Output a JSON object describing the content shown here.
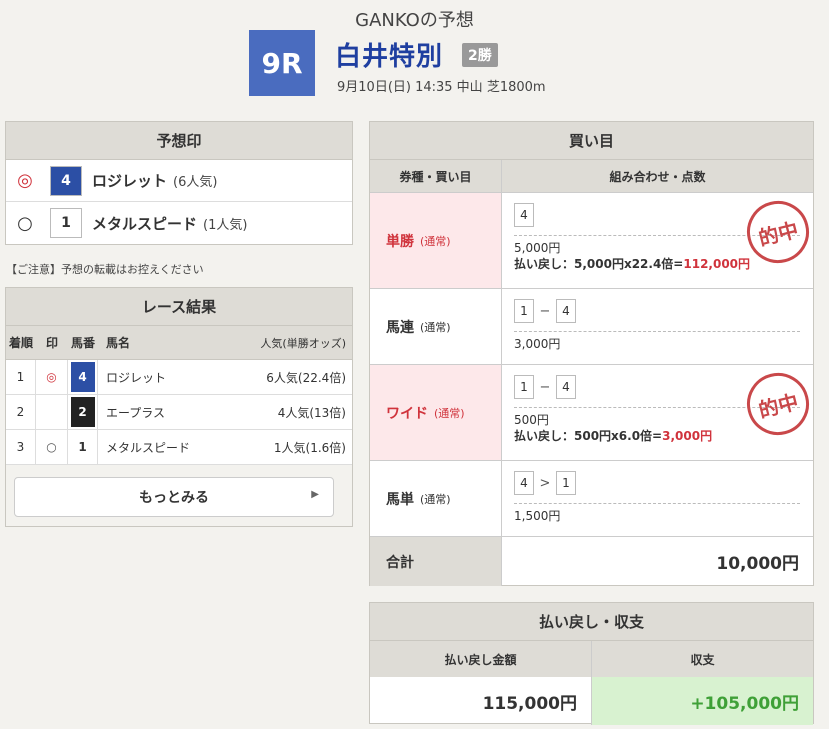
{
  "header": {
    "title": "GANKOの予想",
    "race_no": "9R",
    "race_name": "白井特別",
    "grade": "2勝",
    "info": "9月10日(日) 14:35 中山 芝1800m"
  },
  "prediction": {
    "title": "予想印",
    "rows": [
      {
        "mark": "◎",
        "num": "4",
        "name": "ロジレット",
        "pop": "(6人気)",
        "num_bg": "#2c4fa5",
        "num_fg": "#ffffff"
      },
      {
        "mark": "○",
        "num": "1",
        "name": "メタルスピード",
        "pop": "(1人気)",
        "num_bg": "#ffffff",
        "num_fg": "#333333"
      }
    ]
  },
  "note": "【ご注意】予想の転載はお控えください",
  "result": {
    "title": "レース結果",
    "headers": {
      "pos": "着順",
      "mark": "印",
      "num": "馬番",
      "name": "馬名",
      "pop": "人気(単勝オッズ)"
    },
    "rows": [
      {
        "pos": "1",
        "mark": "◎",
        "num": "4",
        "name": "ロジレット",
        "pop": "6人気(22.4倍)",
        "num_bg": "#2c4fa5",
        "num_fg": "#ffffff"
      },
      {
        "pos": "2",
        "mark": "",
        "num": "2",
        "name": "エープラス",
        "pop": "4人気(13倍)",
        "num_bg": "#222222",
        "num_fg": "#ffffff"
      },
      {
        "pos": "3",
        "mark": "○",
        "num": "1",
        "name": "メタルスピード",
        "pop": "1人気(1.6倍)",
        "num_bg": "#ffffff",
        "num_fg": "#333333"
      }
    ],
    "more_label": "もっとみる",
    "more_arrow": "▶"
  },
  "bets": {
    "title": "買い目",
    "headers": {
      "type": "券種・買い目",
      "combo": "組み合わせ・点数"
    },
    "rows": [
      {
        "type": "単勝",
        "sub": "(通常)",
        "hit": true,
        "combo": [
          "4"
        ],
        "seps": [],
        "amount": "5,000円",
        "payout_prefix": "払い戻し：5,000円x22.4倍=",
        "payout_value": "112,000円",
        "stamp": "的中"
      },
      {
        "type": "馬連",
        "sub": "(通常)",
        "hit": false,
        "combo": [
          "1",
          "4"
        ],
        "seps": [
          "−"
        ],
        "amount": "3,000円"
      },
      {
        "type": "ワイド",
        "sub": "(通常)",
        "hit": true,
        "combo": [
          "1",
          "4"
        ],
        "seps": [
          "−"
        ],
        "amount": "500円",
        "payout_prefix": "払い戻し：500円x6.0倍=",
        "payout_value": "3,000円",
        "stamp": "的中"
      },
      {
        "type": "馬単",
        "sub": "(通常)",
        "hit": false,
        "combo": [
          "4",
          "1"
        ],
        "seps": [
          ">"
        ],
        "amount": "1,500円"
      }
    ],
    "total_label": "合計",
    "total_value": "10,000円"
  },
  "payout": {
    "title": "払い戻し・収支",
    "return_label": "払い戻し金額",
    "profit_label": "収支",
    "return_value": "115,000円",
    "profit_value": "+105,000円"
  },
  "colors": {
    "hit": "#d0333c",
    "profit": "#3fa037",
    "race_num_bg": "#4a6cbf",
    "race_name": "#1f3fa0"
  }
}
